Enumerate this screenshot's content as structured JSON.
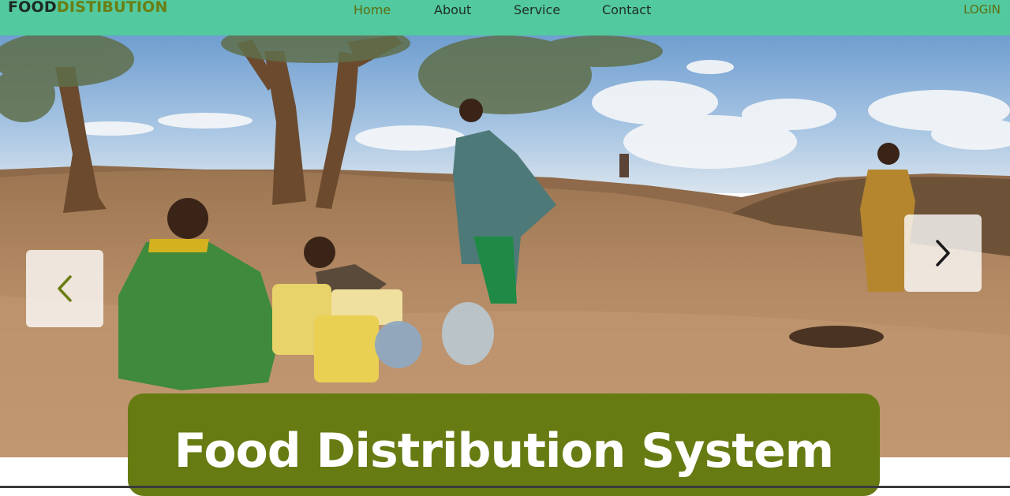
{
  "brand": {
    "part1": "FOOD",
    "part2": "DISTIBUTION"
  },
  "nav": {
    "items": [
      {
        "label": "Home",
        "active": true
      },
      {
        "label": "About",
        "active": false
      },
      {
        "label": "Service",
        "active": false
      },
      {
        "label": "Contact",
        "active": false
      }
    ],
    "login_label": "LOGIN"
  },
  "carousel": {
    "prev_icon": "chevron-left-icon",
    "next_icon": "chevron-right-icon"
  },
  "hero": {
    "title": "Food Distribution System"
  },
  "colors": {
    "navbar": "#52c99e",
    "accent": "#667b12",
    "brand_dark": "#1d2a22",
    "title_text": "#ffffff"
  }
}
